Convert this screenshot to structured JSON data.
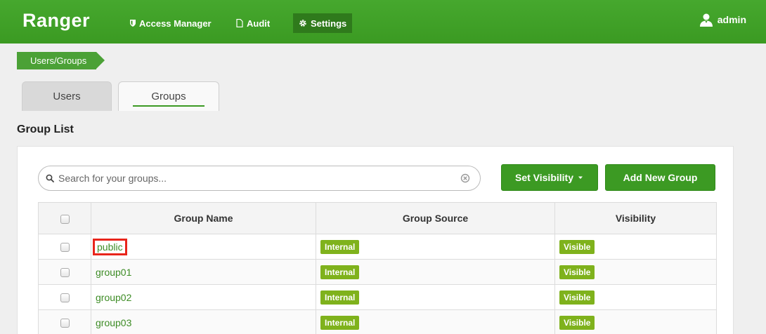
{
  "nav": {
    "brand": "Ranger",
    "items": [
      {
        "label": "Access Manager",
        "icon": "shield-icon"
      },
      {
        "label": "Audit",
        "icon": "file-icon"
      },
      {
        "label": "Settings",
        "icon": "gear-icon"
      }
    ],
    "user": "admin"
  },
  "breadcrumb": "Users/Groups",
  "tabs": [
    {
      "label": "Users"
    },
    {
      "label": "Groups"
    }
  ],
  "section_title": "Group List",
  "search": {
    "placeholder": "Search for your groups..."
  },
  "buttons": {
    "set_visibility": "Set Visibility",
    "add_group": "Add New Group"
  },
  "table": {
    "headers": [
      "Group Name",
      "Group Source",
      "Visibility"
    ],
    "rows": [
      {
        "name": "public",
        "source": "Internal",
        "visibility": "Visible"
      },
      {
        "name": "group01",
        "source": "Internal",
        "visibility": "Visible"
      },
      {
        "name": "group02",
        "source": "Internal",
        "visibility": "Visible"
      },
      {
        "name": "group03",
        "source": "Internal",
        "visibility": "Visible"
      }
    ]
  },
  "colors": {
    "nav": "#3b9a22",
    "accent": "#3c9a23",
    "label": "#7fb21c",
    "highlight": "#e8251b"
  }
}
